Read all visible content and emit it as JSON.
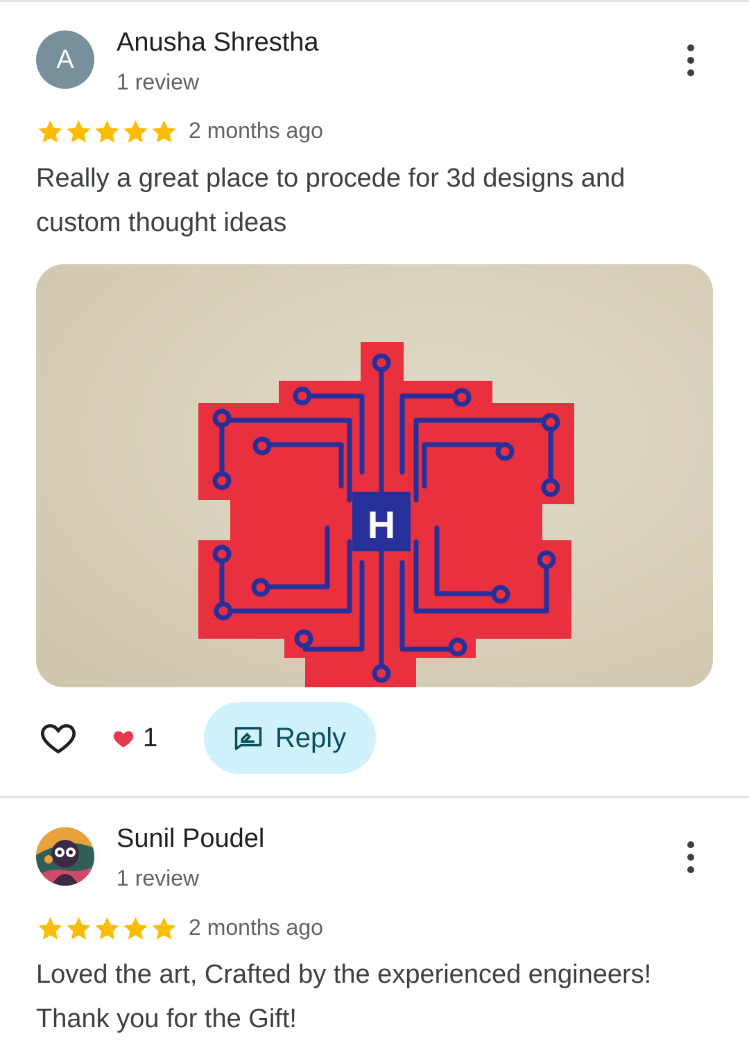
{
  "reviews": [
    {
      "name": "Anusha Shrestha",
      "avatar_letter": "A",
      "review_count": "1 review",
      "rating": 5,
      "time": "2 months ago",
      "text_line1": "Really a great place to procede for 3d designs and",
      "text_line2": "custom thought ideas",
      "photo_letter": "H",
      "reaction_count": "1",
      "reply_label": "Reply"
    },
    {
      "name": "Sunil Poudel",
      "review_count": "1 review",
      "rating": 5,
      "time": "2 months ago",
      "text_line1": "Loved the art, Crafted by the experienced engineers!",
      "text_line2": "Thank you for the Gift!"
    }
  ],
  "colors": {
    "star": "#fbbc04",
    "reply_bg": "#cff2fc",
    "reply_text": "#0b4f5c",
    "avatar_bg": "#78909c",
    "heart": "#e8374e"
  },
  "icons": [
    "more-vert-icon",
    "star-icon",
    "heart-outline-icon",
    "heart-filled-icon",
    "reply-icon"
  ]
}
